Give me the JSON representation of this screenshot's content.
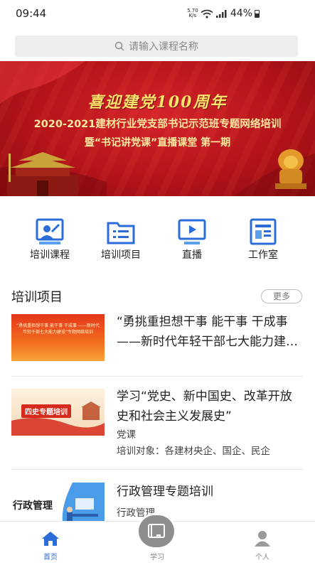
{
  "status_bar": {
    "time": "09:44",
    "net_speed_value": "5.70",
    "net_speed_unit": "K/s",
    "battery": "44%",
    "icons": [
      "wifi-icon",
      "signal-icon",
      "battery-icon"
    ]
  },
  "search": {
    "placeholder": "请输入课程名称",
    "icon": "search-icon"
  },
  "banner": {
    "line1": "喜迎建党100周年",
    "line2": "2020-2021建材行业党支部书记示范班专题网络培训",
    "line3": "暨“书记讲党课”直播课堂 第一期"
  },
  "quick_menu": [
    {
      "label": "培训课程",
      "icon": "teacher-icon"
    },
    {
      "label": "培训项目",
      "icon": "folder-list-icon"
    },
    {
      "label": "直播",
      "icon": "play-screen-icon"
    },
    {
      "label": "工作室",
      "icon": "document-icon"
    }
  ],
  "section": {
    "title": "培训项目",
    "more_label": "更多"
  },
  "courses": [
    {
      "title": "“勇挑重担想干事 能干事 干成事 ——新时代年轻干部七大能力建设”专题网络培训",
      "thumb_text": "“勇挑重担想干事 能干事 干成事 ——新时代年轻干部七大能力建设”专题网络培训"
    },
    {
      "title": "学习“党史、新中国史、改革开放史和社会主义发展史”",
      "subtitle": "党课",
      "audience": "培训对象：各建材央企、国企、民企",
      "thumb_text": "四史专题培训"
    },
    {
      "title": "行政管理专题培训",
      "subtitle": "行政管理",
      "thumb_text": "行政管理"
    }
  ],
  "tab_bar": [
    {
      "label": "首页",
      "icon": "home-icon",
      "active": true
    },
    {
      "label": "学习",
      "icon": "book-icon",
      "active": false
    },
    {
      "label": "个人",
      "icon": "person-icon",
      "active": false
    }
  ],
  "colors": {
    "accent": "#2b6cd9",
    "banner_red": "#c41a20",
    "banner_gold": "#ffe36a"
  }
}
